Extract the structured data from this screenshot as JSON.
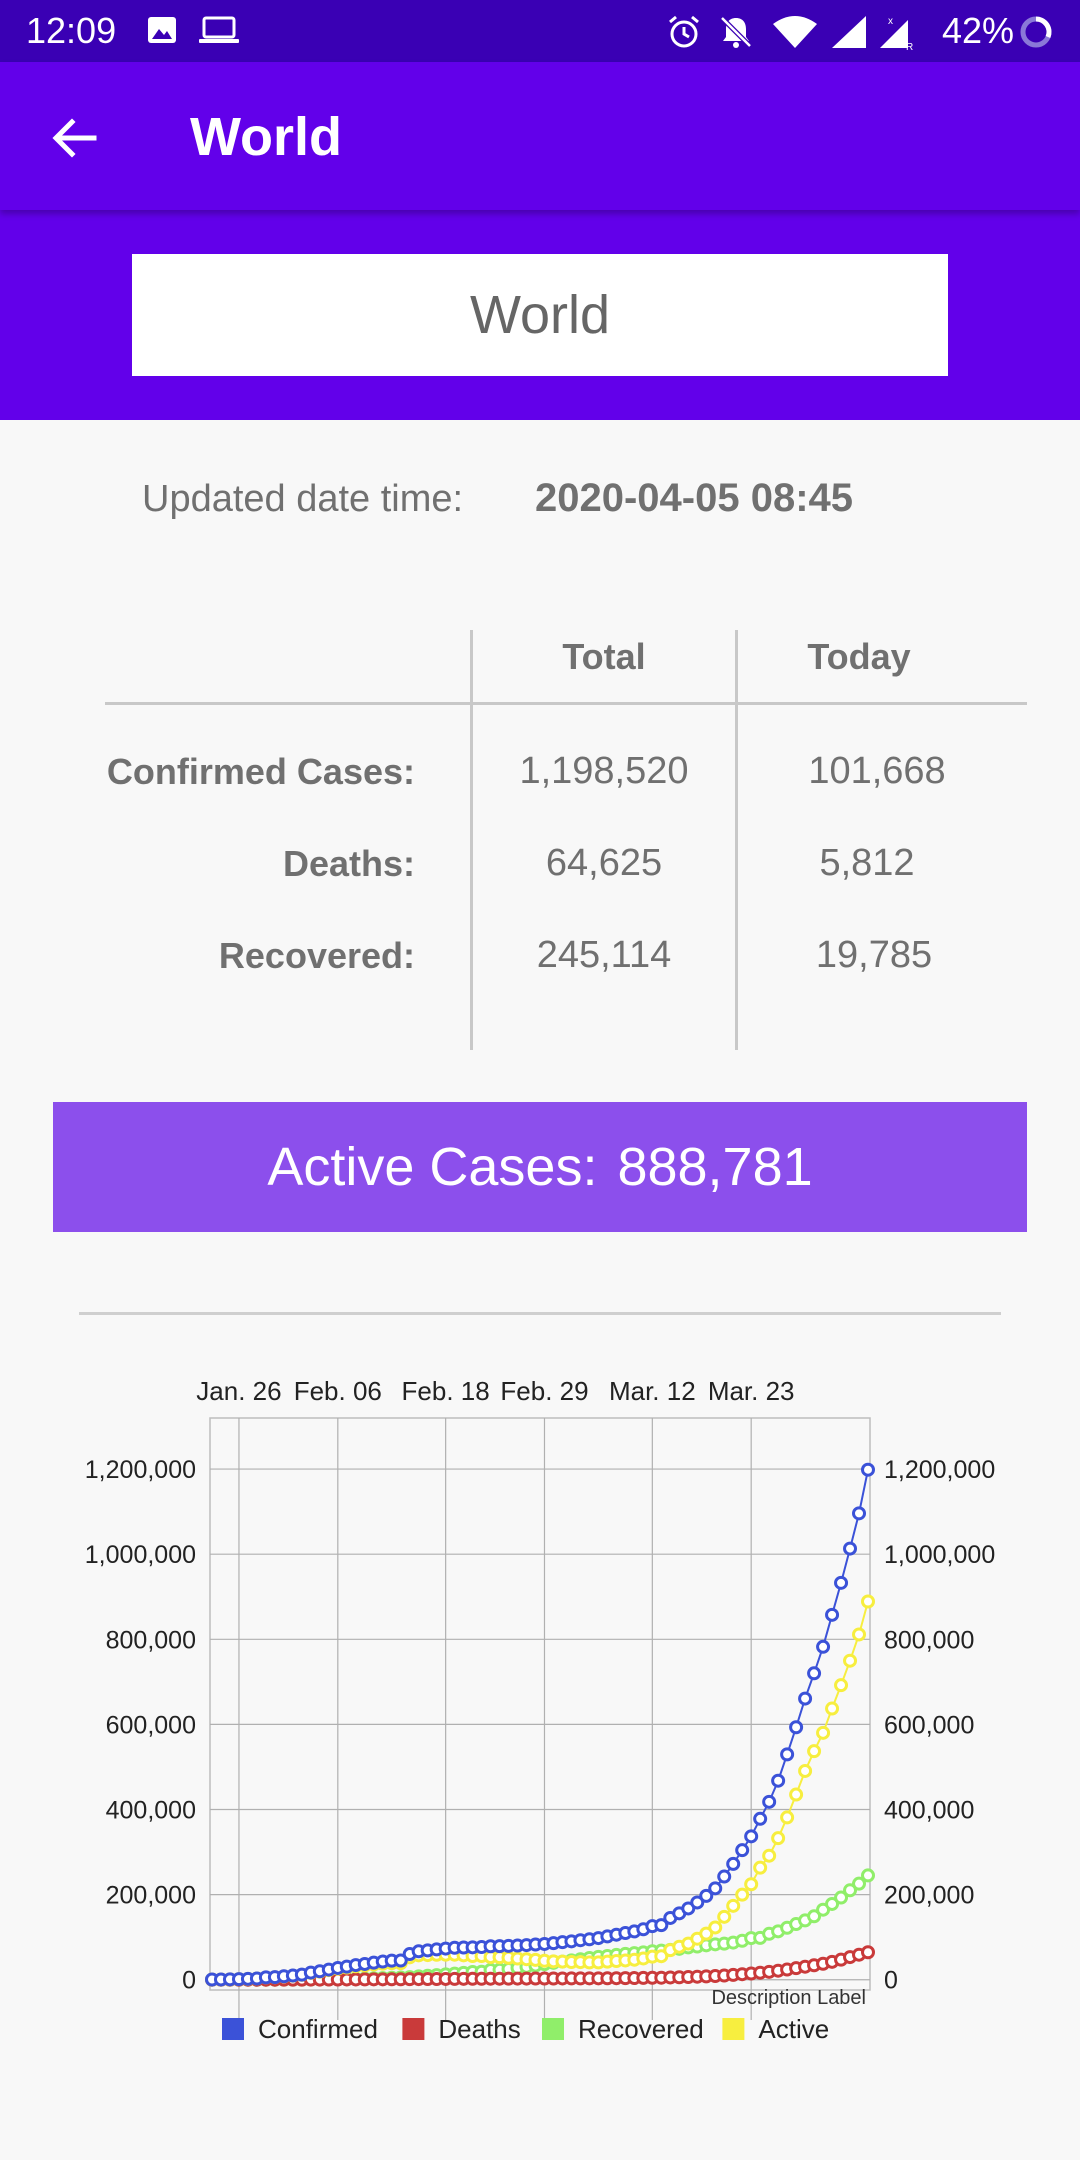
{
  "status_bar": {
    "time": "12:09",
    "battery": "42%"
  },
  "app_bar": {
    "title": "World"
  },
  "country": {
    "selected": "World"
  },
  "updated": {
    "label": "Updated date time:",
    "value": "2020-04-05 08:45"
  },
  "table": {
    "headers": [
      "Total",
      "Today"
    ],
    "rows": [
      {
        "label": "Confirmed Cases:",
        "total": "1,198,520",
        "today": "101,668"
      },
      {
        "label": "Deaths:",
        "total": "64,625",
        "today": "5,812"
      },
      {
        "label": "Recovered:",
        "total": "245,114",
        "today": "19,785"
      }
    ]
  },
  "active": {
    "label": "Active Cases:",
    "value": "888,781"
  },
  "chart_data": {
    "type": "line",
    "x_tick_labels": [
      "Jan. 26",
      "Feb. 06",
      "Feb. 18",
      "Feb. 29",
      "Mar. 12",
      "Mar. 23"
    ],
    "y_tick_labels": [
      "0",
      "200,000",
      "400,000",
      "600,000",
      "800,000",
      "1,000,000",
      "1,200,000"
    ],
    "ylim": [
      -10000,
      1320000
    ],
    "description": "Description Label",
    "grid": true,
    "legend_position": "bottom-left",
    "series": [
      {
        "name": "Confirmed",
        "color": "#3b52d8",
        "values": [
          555,
          654,
          941,
          1434,
          2118,
          2927,
          5578,
          6166,
          8234,
          9927,
          12038,
          16787,
          19881,
          23892,
          27635,
          30817,
          34391,
          37120,
          40150,
          42762,
          44802,
          45221,
          60368,
          66885,
          69030,
          71224,
          73258,
          75136,
          75639,
          76197,
          76819,
          78572,
          78958,
          79561,
          80406,
          81388,
          82746,
          84112,
          86011,
          88369,
          90306,
          92840,
          95120,
          97886,
          101801,
          105847,
          109821,
          113590,
          118620,
          125875,
          128352,
          145205,
          156101,
          167454,
          181574,
          197102,
          214821,
          242570,
          272208,
          304507,
          336953,
          378235,
          418045,
          467653,
          529591,
          593291,
          660706,
          720117,
          782365,
          857487,
          932605,
          1013157,
          1095917,
          1198520
        ]
      },
      {
        "name": "Deaths",
        "color": "#c93a3a",
        "values": [
          17,
          18,
          26,
          42,
          56,
          82,
          131,
          133,
          171,
          213,
          259,
          362,
          426,
          492,
          564,
          634,
          719,
          806,
          906,
          1013,
          1113,
          1118,
          1371,
          1523,
          1666,
          1770,
          1868,
          2007,
          2122,
          2247,
          2251,
          2458,
          2469,
          2629,
          2708,
          2770,
          2814,
          2872,
          2941,
          2996,
          3085,
          3160,
          3254,
          3348,
          3460,
          3558,
          3803,
          3996,
          4262,
          4615,
          4720,
          5404,
          5819,
          6440,
          7126,
          7905,
          8733,
          9867,
          11299,
          12973,
          14651,
          16505,
          18625,
          21181,
          23970,
          27198,
          30652,
          33925,
          37582,
          42107,
          47180,
          53190,
          58787,
          64625
        ]
      },
      {
        "name": "Recovered",
        "color": "#90ee6a",
        "values": [
          28,
          30,
          36,
          39,
          52,
          61,
          107,
          126,
          143,
          222,
          284,
          472,
          623,
          852,
          1124,
          1487,
          2011,
          2616,
          3244,
          3946,
          4683,
          5150,
          6295,
          8058,
          9395,
          10865,
          12583,
          14352,
          16121,
          18177,
          18890,
          22886,
          23394,
          25227,
          27905,
          30384,
          33277,
          36711,
          39782,
          42716,
          45602,
          48228,
          51170,
          53796,
          55865,
          58358,
          60694,
          62494,
          64404,
          67003,
          68324,
          70251,
          72624,
          76034,
          78088,
          80840,
          83207,
          84854,
          87256,
          91603,
          97882,
          98351,
          108000,
          113787,
          122150,
          130915,
          139415,
          149082,
          164566,
          178034,
          193177,
          210263,
          225796,
          245114
        ]
      },
      {
        "name": "Active",
        "color": "#f7ee3f",
        "values": [
          510,
          606,
          879,
          1353,
          2010,
          2784,
          5340,
          5907,
          7920,
          9492,
          11495,
          15953,
          18832,
          22548,
          25947,
          28696,
          31661,
          33698,
          36000,
          37803,
          39006,
          38953,
          52702,
          57304,
          57969,
          58589,
          58807,
          58777,
          57396,
          55773,
          55678,
          53228,
          53095,
          51705,
          49793,
          48234,
          46655,
          44529,
          43288,
          42657,
          41619,
          41452,
          40696,
          40742,
          42476,
          43931,
          45324,
          47100,
          49954,
          54257,
          55308,
          69550,
          77658,
          84980,
          96360,
          108357,
          122881,
          147849,
          173653,
          199931,
          224420,
          263379,
          291420,
          332685,
          381471,
          435178,
          490639,
          537110,
          580217,
          637346,
          692248,
          749704,
          811334,
          888781
        ]
      }
    ]
  },
  "icons": {
    "back": "arrow-left-icon",
    "gallery": "image-icon",
    "laptop": "laptop-icon",
    "alarm": "alarm-icon",
    "mute": "notifications-off-icon",
    "wifi": "wifi-icon",
    "signal": "signal-icon",
    "battery": "battery-circle-icon"
  }
}
